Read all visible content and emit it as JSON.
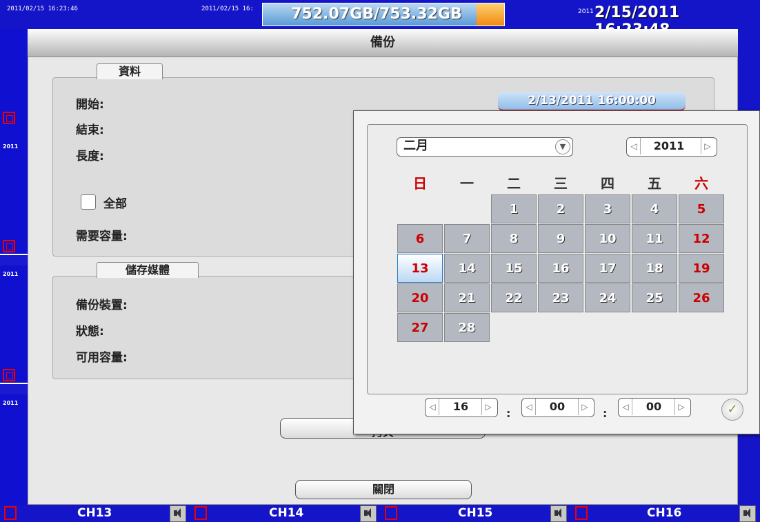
{
  "status_bar": {
    "ts_1": "2011/02/15 16:23:46",
    "ts_2": "2011/02/15 16:",
    "capacity": "752.07GB/753.32GB",
    "clock_prefix": "2011",
    "clock": "2/15/2011 16:23:48"
  },
  "left_strip": {
    "timestamps": [
      "2011",
      "2011",
      "2011"
    ]
  },
  "dialog": {
    "title": "備份",
    "data_group": {
      "label": "資料",
      "start_label": "開始:",
      "start_value": "2/13/2011 16:00:00",
      "end_label": "結束:",
      "length_label": "長度:",
      "all_label": "全部",
      "required_label": "需要容量:"
    },
    "storage_group": {
      "label": "儲存媒體",
      "device_label": "備份裝置:",
      "status_label": "狀態:",
      "available_label": "可用容量:"
    },
    "copy_button": "拷貝",
    "close_button": "關閉"
  },
  "calendar": {
    "month": "二月",
    "year": "2011",
    "weekdays": [
      "日",
      "一",
      "二",
      "三",
      "四",
      "五",
      "六"
    ],
    "days": [
      "1",
      "2",
      "3",
      "4",
      "5",
      "6",
      "7",
      "8",
      "9",
      "10",
      "11",
      "12",
      "13",
      "14",
      "15",
      "16",
      "17",
      "18",
      "19",
      "20",
      "21",
      "22",
      "23",
      "24",
      "25",
      "26",
      "27",
      "28"
    ],
    "selected_day": "13",
    "hour": "16",
    "minute": "00",
    "second": "00",
    "colon": ":"
  },
  "channels": [
    "CH13",
    "CH14",
    "CH15",
    "CH16"
  ],
  "colors": {
    "background": "#1a1ad0",
    "weekend": "#cc0000",
    "selected": "#2c78c0",
    "ok": "#7a9a28"
  },
  "icons": [
    "record-icon",
    "speaker-icon",
    "chevron-down-icon",
    "arrow-left-icon",
    "arrow-right-icon",
    "check-icon"
  ]
}
